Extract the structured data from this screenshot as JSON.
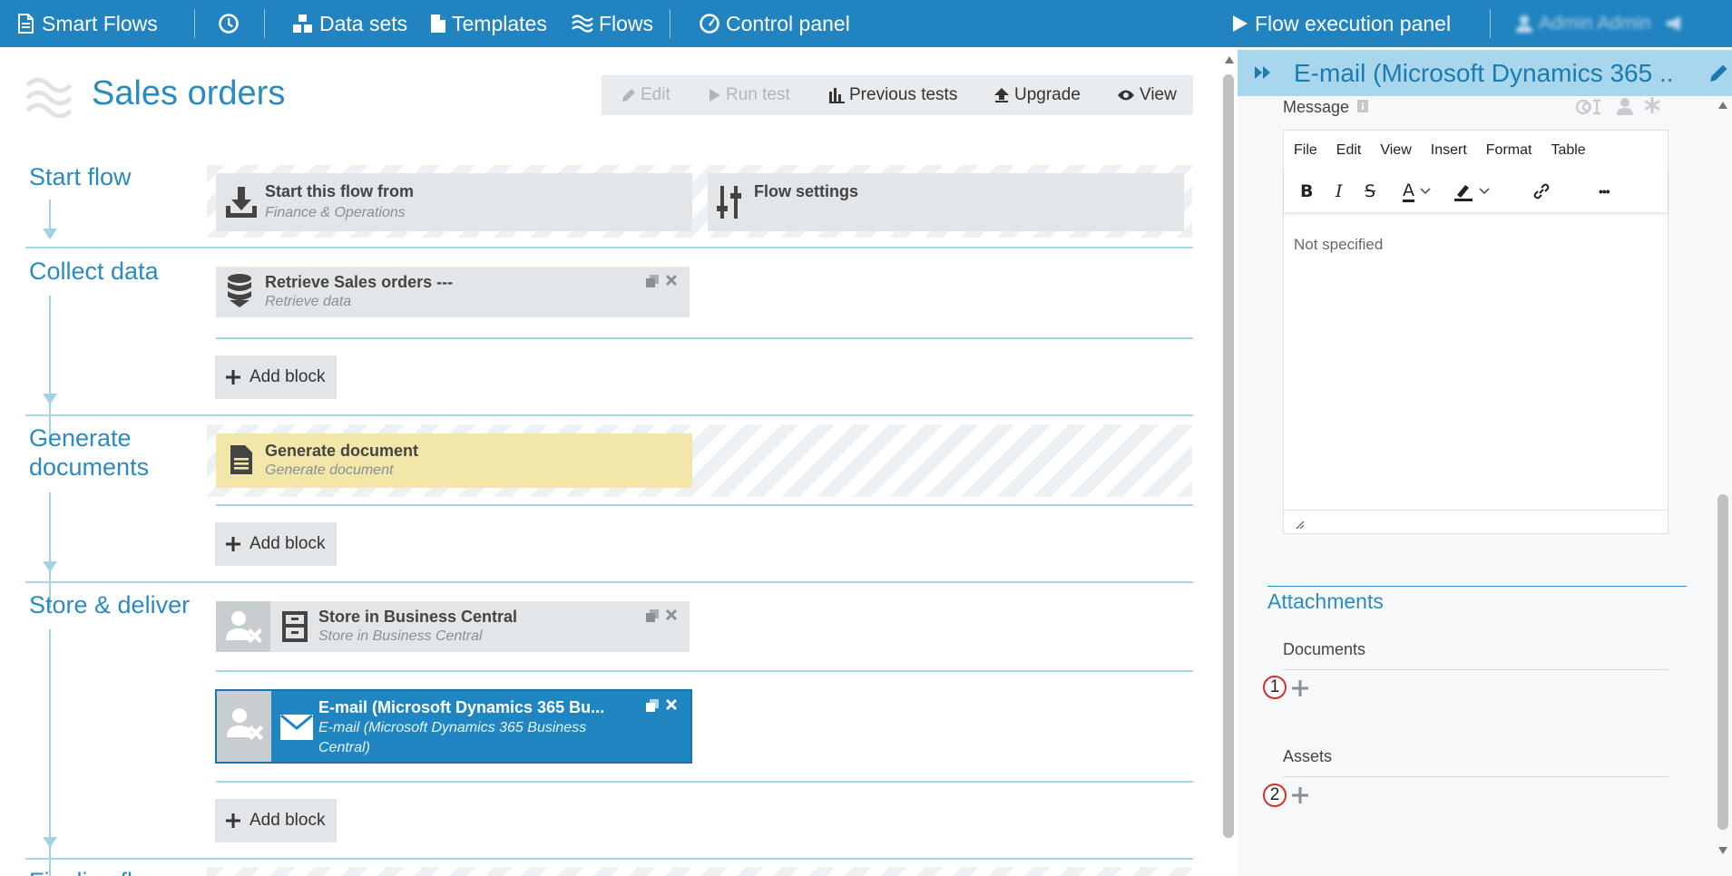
{
  "topbar": {
    "brand": "Smart Flows",
    "nav": [
      "Data sets",
      "Templates",
      "Flows",
      "Control panel"
    ],
    "execution_panel": "Flow execution panel",
    "user": "Admin Admin"
  },
  "page": {
    "title": "Sales orders",
    "toolbar": {
      "edit": "Edit",
      "run_test": "Run test",
      "previous_tests": "Previous tests",
      "upgrade": "Upgrade",
      "view": "View"
    }
  },
  "sections": {
    "start": "Start flow",
    "collect": "Collect data",
    "generate_1": "Generate",
    "generate_2": "documents",
    "store": "Store & deliver",
    "cut_off": "Finalize flow"
  },
  "blocks": {
    "start_from": {
      "title": "Start this flow from",
      "subtitle": "Finance & Operations"
    },
    "flow_settings": {
      "title": "Flow settings"
    },
    "retrieve": {
      "title": "Retrieve Sales orders ---",
      "subtitle": "Retrieve data"
    },
    "generate": {
      "title": "Generate document",
      "subtitle": "Generate document"
    },
    "store_bc": {
      "title": "Store in Business Central",
      "subtitle": "Store in Business Central"
    },
    "email": {
      "title": "E-mail (Microsoft Dynamics 365 Bu...",
      "subtitle": "E-mail (Microsoft Dynamics 365 Business Central)"
    }
  },
  "add_block_label": "Add block",
  "panel": {
    "title": "E-mail (Microsoft Dynamics 365 ...",
    "message_label": "Message",
    "editor_menu": [
      "File",
      "Edit",
      "View",
      "Insert",
      "Format",
      "Table"
    ],
    "editor_bold": "B",
    "editor_italic": "I",
    "editor_strike": "S",
    "editor_color": "A",
    "editor_more": "•••",
    "editor_content": "Not specified",
    "attachments_title": "Attachments",
    "documents_label": "Documents",
    "assets_label": "Assets",
    "badge_1": "1",
    "badge_2": "2"
  },
  "colors": {
    "topbar": "#2184c0",
    "accent": "#2a8bbf",
    "selected_block": "#1f86c2",
    "document_block": "#f2e6a8",
    "badge_ring": "#d32f2f"
  }
}
